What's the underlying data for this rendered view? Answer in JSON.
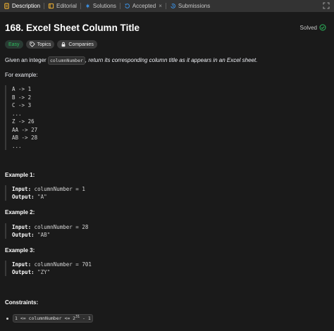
{
  "tabs": [
    {
      "label": "Description",
      "icon": "description-icon",
      "active": true
    },
    {
      "label": "Editorial",
      "icon": "editorial-icon"
    },
    {
      "label": "Solutions",
      "icon": "solutions-icon"
    },
    {
      "label": "Accepted",
      "icon": "accepted-icon",
      "closable": true
    },
    {
      "label": "Submissions",
      "icon": "submissions-icon"
    }
  ],
  "close_glyph": "×",
  "problem": {
    "title": "168. Excel Sheet Column Title",
    "status": "Solved",
    "difficulty": "Easy",
    "topics_label": "Topics",
    "companies_label": "Companies",
    "intro_before": "Given an integer ",
    "intro_code": "columnNumber",
    "intro_after": ", return its corresponding column title as it appears in an Excel sheet.",
    "for_example": "For example:",
    "mapping": [
      "A -> 1",
      "B -> 2",
      "C -> 3",
      "...",
      "Z -> 26",
      "AA -> 27",
      "AB -> 28",
      "..."
    ]
  },
  "examples": [
    {
      "heading": "Example 1:",
      "input_label": "Input:",
      "input_value": " columnNumber = 1",
      "output_label": "Output:",
      "output_value": " \"A\""
    },
    {
      "heading": "Example 2:",
      "input_label": "Input:",
      "input_value": " columnNumber = 28",
      "output_label": "Output:",
      "output_value": " \"AB\""
    },
    {
      "heading": "Example 3:",
      "input_label": "Input:",
      "input_value": " columnNumber = 701",
      "output_label": "Output:",
      "output_value": " \"ZY\""
    }
  ],
  "constraints": {
    "heading": "Constraints:",
    "text_before": "1 <= columnNumber <= 2",
    "exponent": "31",
    "text_after": " - 1"
  },
  "colors": {
    "accent_green": "#2cbb5d",
    "background": "#1a1a1a",
    "tabbar": "#333333"
  }
}
